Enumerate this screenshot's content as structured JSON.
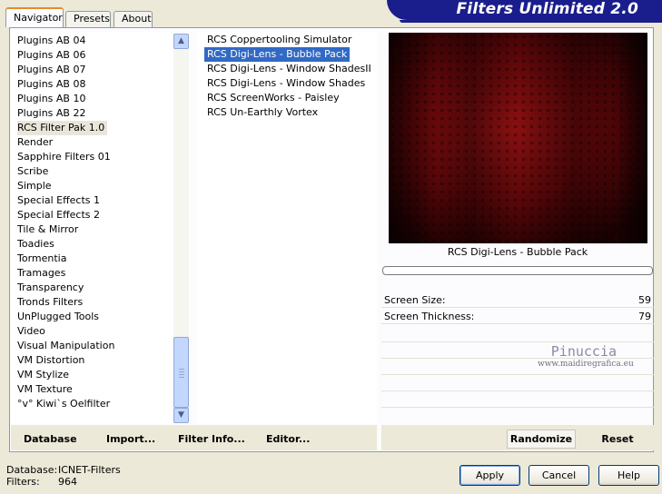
{
  "tabs": [
    "Navigator",
    "Presets",
    "About"
  ],
  "banner_title": "Filters Unlimited 2.0",
  "categories": [
    "Plugins AB 04",
    "Plugins AB 06",
    "Plugins AB 07",
    "Plugins AB 08",
    "Plugins AB 10",
    "Plugins AB 22",
    "RCS Filter Pak 1.0",
    "Render",
    "Sapphire Filters 01",
    "Scribe",
    "Simple",
    "Special Effects 1",
    "Special Effects 2",
    "Tile & Mirror",
    "Toadies",
    "Tormentia",
    "Tramages",
    "Transparency",
    "Tronds Filters",
    "UnPlugged Tools",
    "Video",
    "Visual Manipulation",
    "VM Distortion",
    "VM Stylize",
    "VM Texture",
    "°v° Kiwi`s Oelfilter"
  ],
  "selected_category": "RCS Filter Pak 1.0",
  "filters": [
    "RCS Coppertooling Simulator",
    "RCS Digi-Lens - Bubble Pack",
    "RCS Digi-Lens - Window ShadesII",
    "RCS Digi-Lens - Window Shades",
    "RCS ScreenWorks - Paisley",
    "RCS Un-Earthly Vortex"
  ],
  "selected_filter": "RCS Digi-Lens - Bubble Pack",
  "current_filter_name": "RCS Digi-Lens - Bubble Pack",
  "params": [
    {
      "label": "Screen Size:",
      "value": "59"
    },
    {
      "label": "Screen Thickness:",
      "value": "79"
    }
  ],
  "watermark": {
    "name": "Pinuccia",
    "site": "www.maidiregrafica.eu"
  },
  "left_buttons": {
    "database": "Database",
    "import": "Import...",
    "filter_info": "Filter Info...",
    "editor": "Editor..."
  },
  "right_buttons": {
    "randomize": "Randomize",
    "reset": "Reset"
  },
  "status": {
    "database_label": "Database:",
    "database_value": "ICNET-Filters",
    "filters_label": "Filters:",
    "filters_value": "964"
  },
  "dialog_buttons": {
    "apply": "Apply",
    "cancel": "Cancel",
    "help": "Help"
  },
  "icons": {
    "scroll_up": "arrow-up-icon",
    "scroll_down": "arrow-down-icon"
  },
  "colors": {
    "banner": "#1a1e8c",
    "selection": "#316ac5",
    "preview_base": "#5a0608"
  }
}
